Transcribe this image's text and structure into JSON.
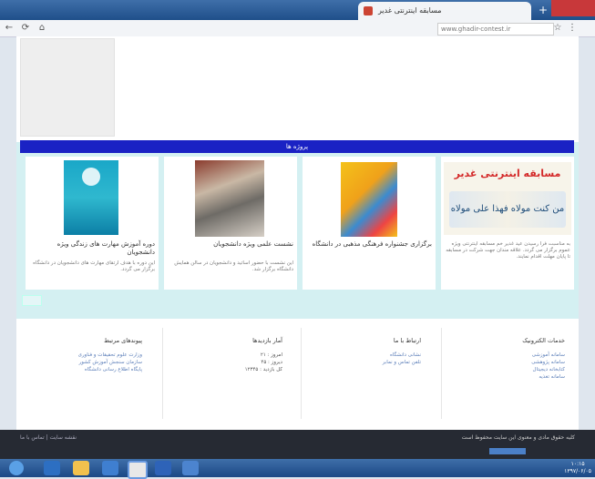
{
  "browser": {
    "tab_title": "مسابقه اینترنتی غدیر",
    "url": "www.ghadir-contest.ir",
    "new_tab_label": "+"
  },
  "page": {
    "section_title": "پروژه ها",
    "cards": [
      {
        "image_text_line1": "مسابقه اینترنتی غدیر",
        "image_text_line2": "من کنت مولاه فهذا علی مولاه",
        "title": "",
        "desc": "به مناسبت فرا رسیدن عید غدیر خم مسابقه اینترنتی ویژه عموم برگزار می گردد. علاقه مندان جهت شرکت در مسابقه تا پایان مهلت اقدام نمایند."
      },
      {
        "image_text_line1": "",
        "image_text_line2": "",
        "title": "برگزاری جشنواره فرهنگی مذهبی در دانشگاه",
        "desc": ""
      },
      {
        "image_text_line1": "",
        "image_text_line2": "",
        "title": "نشست علمی ویژه دانشجویان",
        "desc": "این نشست با حضور اساتید و دانشجویان در سالن همایش دانشگاه برگزار شد."
      },
      {
        "image_text_line1": "",
        "image_text_line2": "",
        "title": "دوره آموزش مهارت های زندگی ویژه دانشجویان",
        "desc": "این دوره با هدف ارتقای مهارت های دانشجویان در دانشگاه برگزار می گردد."
      }
    ]
  },
  "footer": {
    "columns": [
      {
        "head": "خدمات الکترونیک",
        "links": [
          "سامانه آموزشی",
          "سامانه پژوهشی",
          "کتابخانه دیجیتال",
          "سامانه تغذیه"
        ]
      },
      {
        "head": "ارتباط با ما",
        "links": [
          "نشانی دانشگاه",
          "تلفن تماس و نمابر"
        ]
      },
      {
        "head": "آمار بازدیدها",
        "links": [
          "امروز : ۲۱",
          "دیروز : ۴۵",
          "کل بازدید : ۱۲۳۴۵"
        ]
      },
      {
        "head": "پیوندهای مرتبط",
        "links": [
          "وزارت علوم تحقیقات و فناوری",
          "سازمان سنجش آموزش کشور",
          "پایگاه اطلاع رسانی دانشگاه"
        ]
      }
    ],
    "copyright": "کلیه حقوق مادی و معنوی این سایت محفوظ است",
    "bottom_links": "نقشه سایت | تماس با ما"
  },
  "taskbar": {
    "time": "۱۰:۱۵",
    "date": "۱۳۹۷/۰۶/۰۵"
  },
  "colors": {
    "section_bar": "#1a22c4",
    "page_bg": "#d4f0f2",
    "footer_dark": "#262a33",
    "link": "#5a7db8"
  }
}
